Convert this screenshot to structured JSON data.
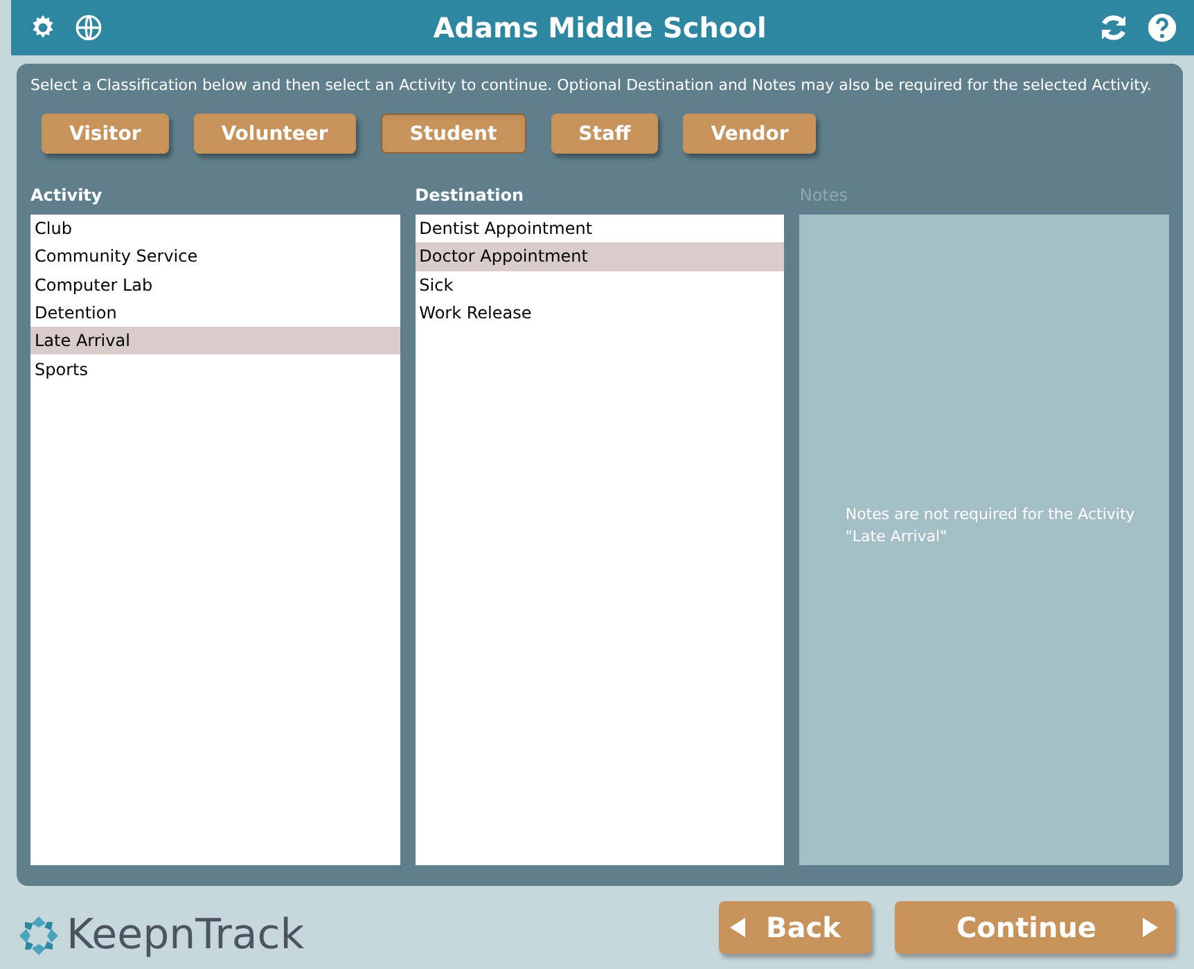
{
  "header": {
    "title": "Adams Middle School"
  },
  "instructions": "Select a Classification below and then select an Activity to continue. Optional Destination and Notes may also be required for the selected Activity.",
  "classifications": [
    {
      "label": "Visitor",
      "selected": false
    },
    {
      "label": "Volunteer",
      "selected": false
    },
    {
      "label": "Student",
      "selected": true
    },
    {
      "label": "Staff",
      "selected": false
    },
    {
      "label": "Vendor",
      "selected": false
    }
  ],
  "activity": {
    "label": "Activity",
    "items": [
      {
        "label": "Club",
        "selected": false
      },
      {
        "label": "Community Service",
        "selected": false
      },
      {
        "label": "Computer Lab",
        "selected": false
      },
      {
        "label": "Detention",
        "selected": false
      },
      {
        "label": "Late Arrival",
        "selected": true
      },
      {
        "label": "Sports",
        "selected": false
      }
    ]
  },
  "destination": {
    "label": "Destination",
    "items": [
      {
        "label": "Dentist Appointment",
        "selected": false
      },
      {
        "label": "Doctor Appointment",
        "selected": true
      },
      {
        "label": "Sick",
        "selected": false
      },
      {
        "label": "Work Release",
        "selected": false
      }
    ]
  },
  "notes": {
    "label": "Notes",
    "disabled": true,
    "message": "Notes are not required for the Activity \"Late Arrival\""
  },
  "footer": {
    "logo": "KeepnTrack",
    "back": "Back",
    "continue": "Continue"
  }
}
